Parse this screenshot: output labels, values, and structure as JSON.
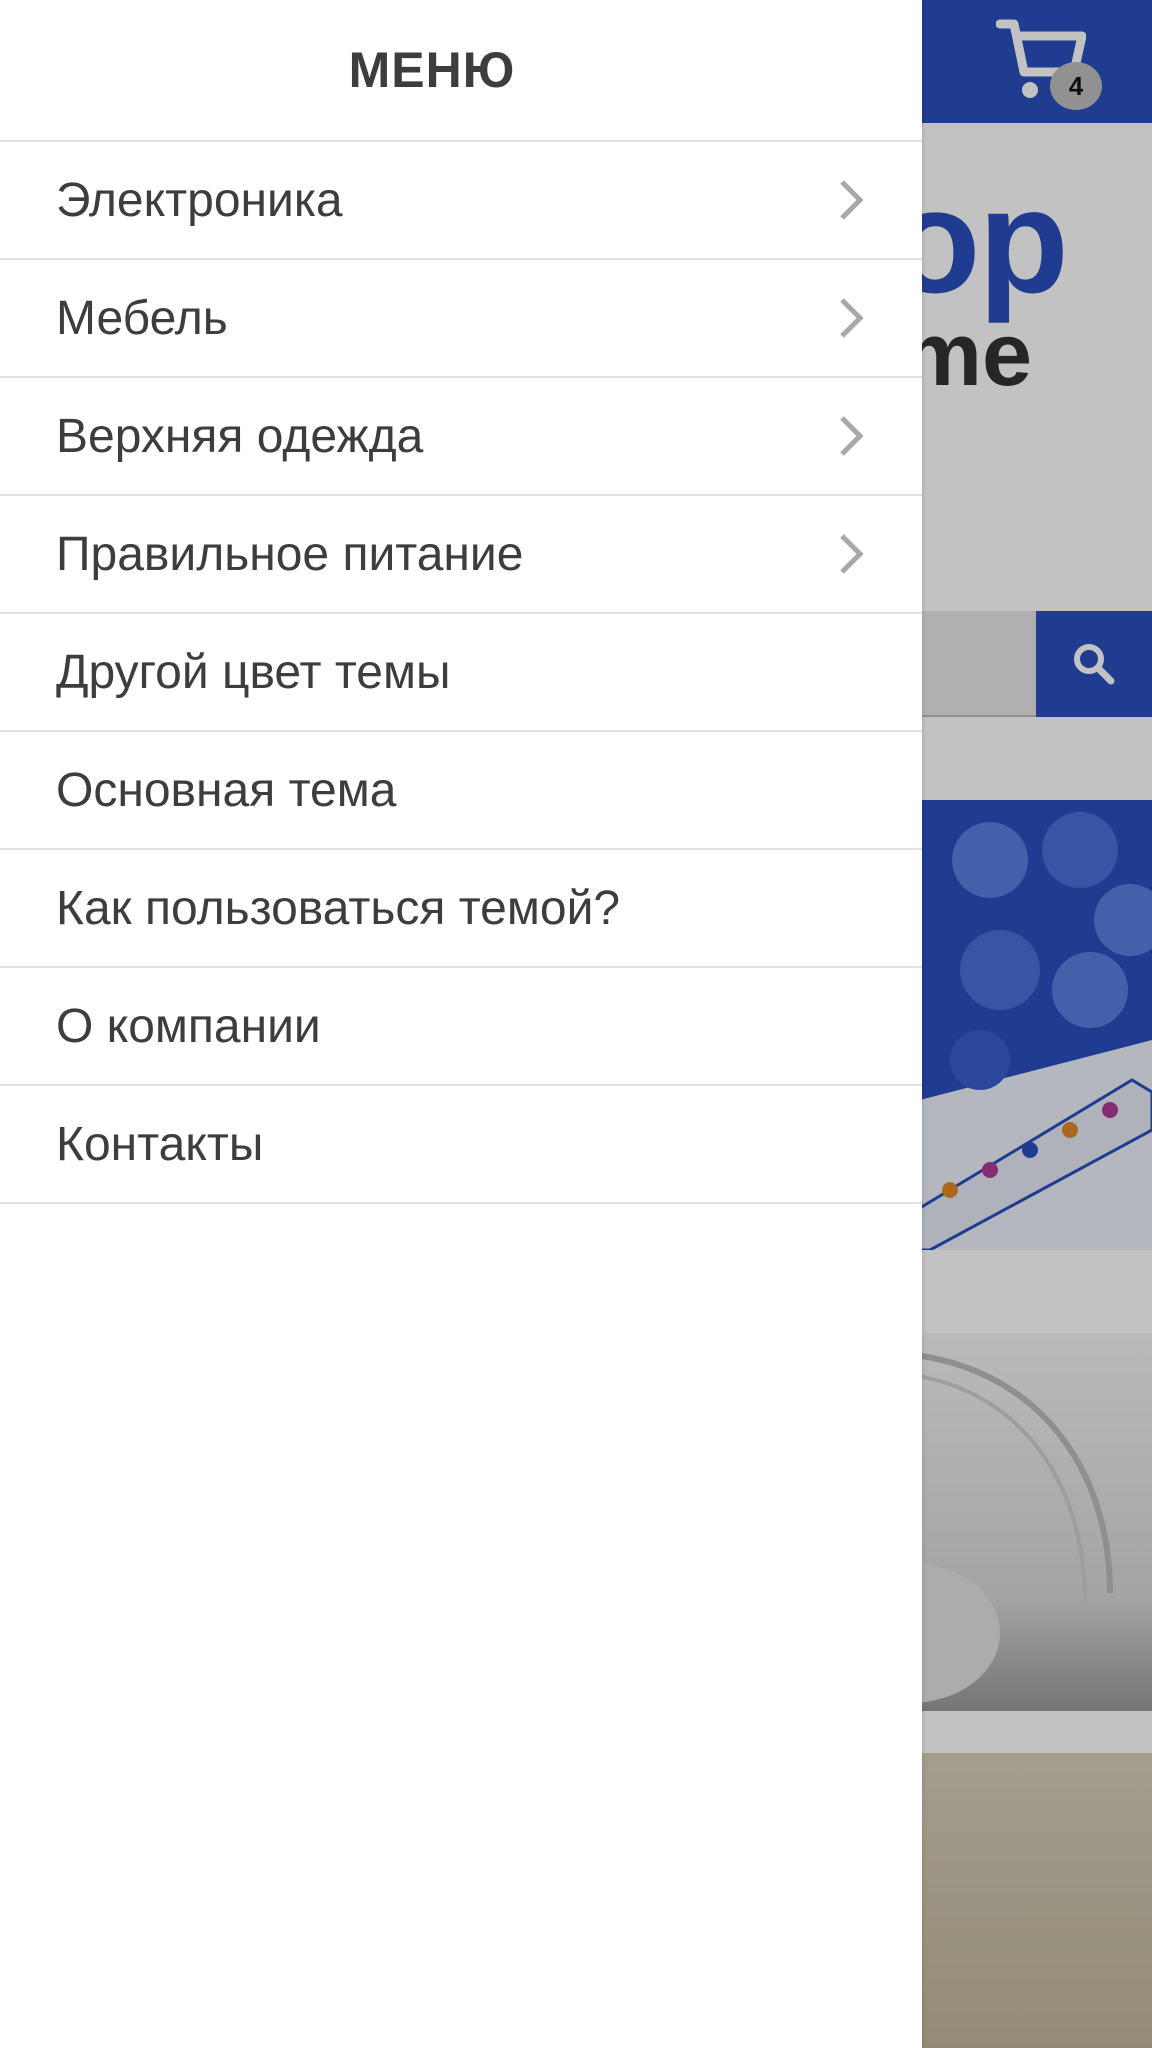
{
  "header": {
    "cart_count": "4",
    "cart_icon": "cart-icon",
    "search_icon": "search-icon",
    "brand_color": "#2a50bf"
  },
  "logo": {
    "part1": "op",
    "part2": "me"
  },
  "menu": {
    "title": "МЕНЮ",
    "items": [
      {
        "label": "Электроника",
        "has_submenu": true
      },
      {
        "label": "Мебель",
        "has_submenu": true
      },
      {
        "label": "Верхняя одежда",
        "has_submenu": true
      },
      {
        "label": "Правильное питание",
        "has_submenu": true
      },
      {
        "label": "Другой цвет темы",
        "has_submenu": false
      },
      {
        "label": "Основная тема",
        "has_submenu": false
      },
      {
        "label": "Как пользоваться темой?",
        "has_submenu": false
      },
      {
        "label": "О компании",
        "has_submenu": false
      },
      {
        "label": "Контакты",
        "has_submenu": false
      }
    ]
  }
}
